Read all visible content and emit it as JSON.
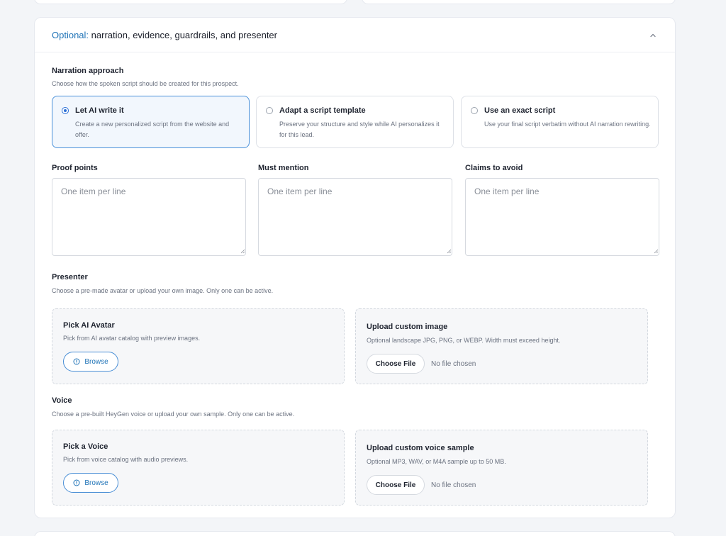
{
  "header": {
    "optional_prefix": "Optional:",
    "title": "narration, evidence, guardrails, and presenter",
    "toggle_icon": "chevron-up-icon"
  },
  "narration": {
    "label": "Narration approach",
    "help": "Choose how the spoken script should be created for this prospect.",
    "options": [
      {
        "title": "Let AI write it",
        "desc": "Create a new personalized script from the website and offer.",
        "selected": true
      },
      {
        "title": "Adapt a script template",
        "desc": "Preserve your structure and style while AI personalizes it for this lead.",
        "selected": false
      },
      {
        "title": "Use an exact script",
        "desc": "Use your final script verbatim without AI narration rewriting.",
        "selected": false
      }
    ]
  },
  "fields": [
    {
      "label": "Proof points",
      "placeholder": "One item per line",
      "value": ""
    },
    {
      "label": "Must mention",
      "placeholder": "One item per line",
      "value": ""
    },
    {
      "label": "Claims to avoid",
      "placeholder": "One item per line",
      "value": ""
    }
  ],
  "presenter": {
    "label": "Presenter",
    "help": "Choose a pre-made avatar or upload your own image. Only one can be active.",
    "pick": {
      "title": "Pick AI Avatar",
      "desc": "Pick from AI avatar catalog with preview images.",
      "button": "Browse",
      "icon": "info-circle-icon"
    },
    "upload": {
      "title": "Upload custom image",
      "desc": "Optional landscape JPG, PNG, or WEBP. Width must exceed height.",
      "button": "Choose File",
      "status": "No file chosen"
    }
  },
  "voice": {
    "label": "Voice",
    "help": "Choose a pre-built HeyGen voice or upload your own sample. Only one can be active.",
    "pick": {
      "title": "Pick a Voice",
      "desc": "Pick from voice catalog with audio previews.",
      "button": "Browse",
      "icon": "info-circle-icon"
    },
    "upload": {
      "title": "Upload custom voice sample",
      "desc": "Optional MP3, WAV, or M4A sample up to 50 MB.",
      "button": "Choose File",
      "status": "No file chosen"
    }
  },
  "colors": {
    "accent": "#1f73b7",
    "selected_border": "#4a90d9",
    "selected_bg": "#f2f7fd",
    "page_bg": "#f3f5f8"
  }
}
